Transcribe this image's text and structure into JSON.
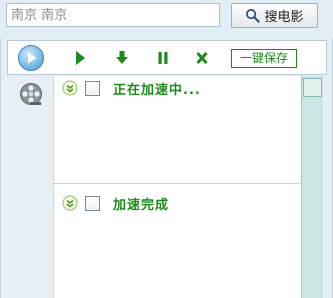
{
  "search": {
    "value": "南京 南京",
    "button_label": "搜电影"
  },
  "toolbar": {
    "save_label": "一键保存"
  },
  "tasks": [
    {
      "label": "正在加速中..."
    },
    {
      "label": "加速完成"
    }
  ],
  "colors": {
    "accent_green": "#1e8a1e",
    "toolbar_circle": "#4a9fd8",
    "scrollbar_track": "#cbe5e3"
  }
}
